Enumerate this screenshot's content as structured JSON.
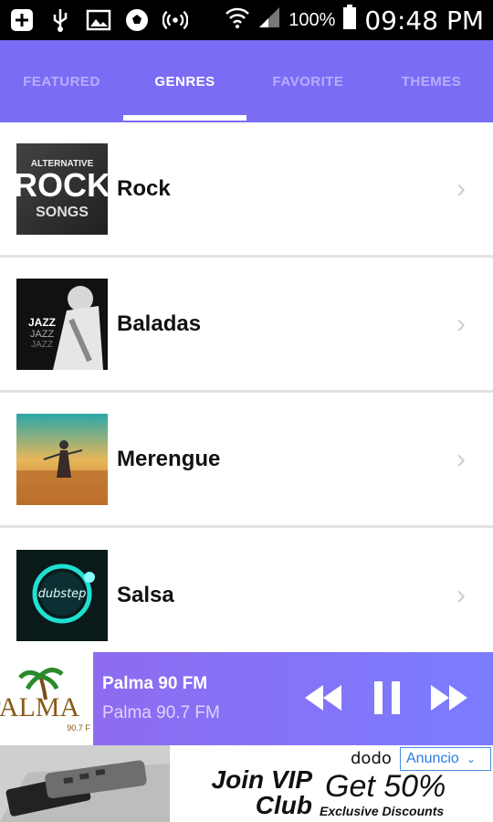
{
  "status_bar": {
    "battery": "100%",
    "time": "09:48 PM",
    "icons": [
      "add-icon",
      "usb-icon",
      "image-icon",
      "soccer-ball-icon",
      "broadcast-icon",
      "wifi-icon",
      "signal-icon",
      "battery-icon"
    ]
  },
  "tabs": [
    {
      "label": "FEATURED",
      "active": false
    },
    {
      "label": "GENRES",
      "active": true
    },
    {
      "label": "FAVORITE",
      "active": false
    },
    {
      "label": "THEMES",
      "active": false
    }
  ],
  "genres": [
    {
      "label": "Rock",
      "art_text": "ALTERNATIVE ROCK SONGS"
    },
    {
      "label": "Baladas",
      "art_text": "JAZZ JAZZ JAZZ"
    },
    {
      "label": "Merengue"
    },
    {
      "label": "Salsa",
      "art_text": "dubstep"
    }
  ],
  "player": {
    "title": "Palma 90 FM",
    "subtitle": "Palma 90.7 FM",
    "logo_text": "PALMA",
    "logo_sub": "90.7 F"
  },
  "ad": {
    "brand": "dodo",
    "label": "Anuncio",
    "join": "Join VIP Club",
    "offer": "Get 50%",
    "tagline": "Exclusive Discounts"
  },
  "colors": {
    "accent": "#7b6cf6",
    "player_gradient_start": "#8e6bf0",
    "player_gradient_end": "#7b7cff"
  }
}
